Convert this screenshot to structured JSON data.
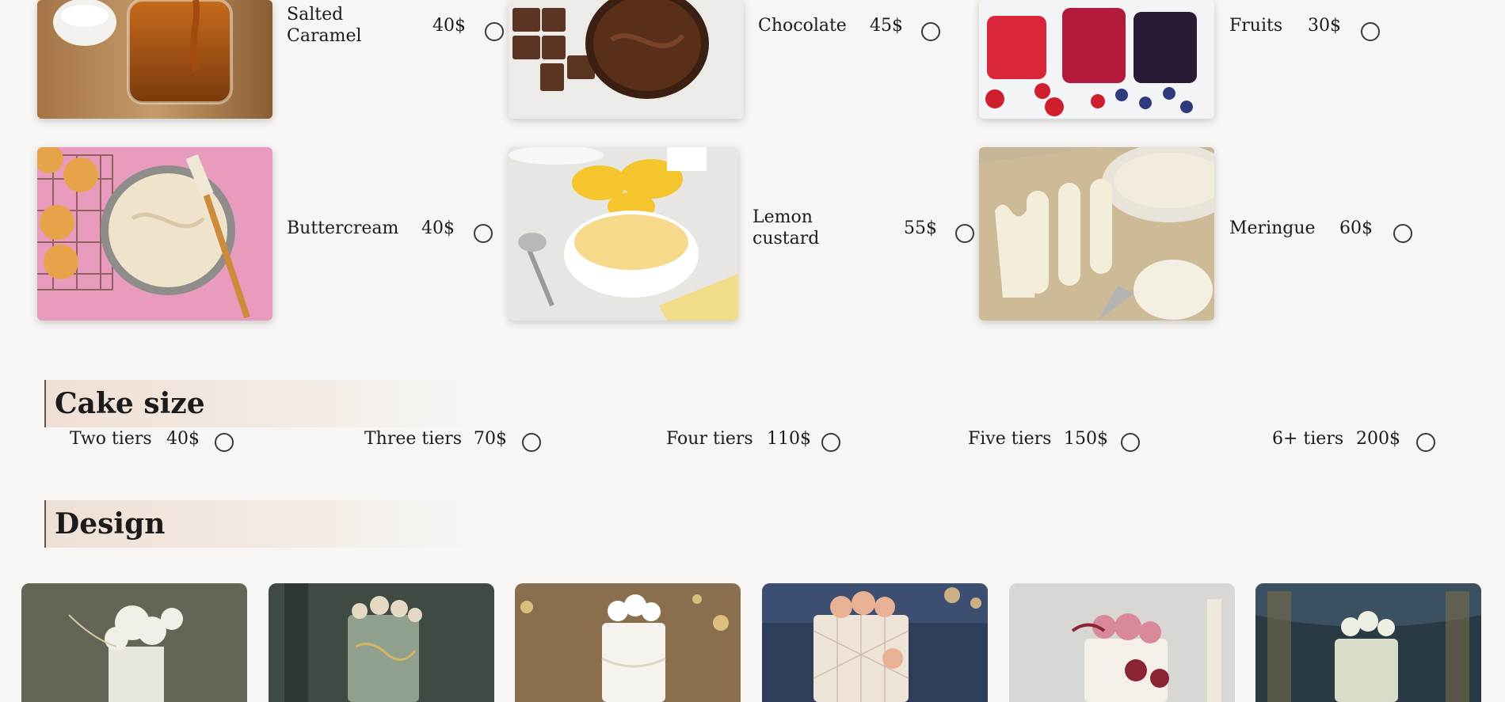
{
  "fillings": [
    {
      "label": "Salted Caramel",
      "price": "40$",
      "image": "salted-caramel-image"
    },
    {
      "label": "Chocolate",
      "price": "45$",
      "image": "chocolate-image"
    },
    {
      "label": "Fruits",
      "price": "30$",
      "image": "fruits-image"
    },
    {
      "label": "Buttercream",
      "price": "40$",
      "image": "buttercream-image"
    },
    {
      "label": "Lemon custard",
      "price": "55$",
      "image": "lemon-custard-image"
    },
    {
      "label": "Meringue",
      "price": "60$",
      "image": "meringue-image"
    }
  ],
  "cake_size": {
    "title": "Cake size",
    "options": [
      {
        "label": "Two tiers",
        "price": "40$"
      },
      {
        "label": "Three tiers",
        "price": "70$"
      },
      {
        "label": "Four tiers",
        "price": "110$"
      },
      {
        "label": "Five tiers",
        "price": "150$"
      },
      {
        "label": "6+ tiers",
        "price": "200$"
      }
    ]
  },
  "design": {
    "title": "Design",
    "cards": [
      {
        "image": "white-floral-cake-image"
      },
      {
        "image": "sage-gold-cake-image"
      },
      {
        "image": "white-rose-cake-image"
      },
      {
        "image": "peach-rose-cake-image"
      },
      {
        "image": "pink-rose-cake-image"
      },
      {
        "image": "green-baroque-cake-image"
      }
    ]
  },
  "colors": {
    "background": "#f7f6f4",
    "header_gradient": "#efe0d6",
    "radio_border": "#3a3a3a"
  }
}
